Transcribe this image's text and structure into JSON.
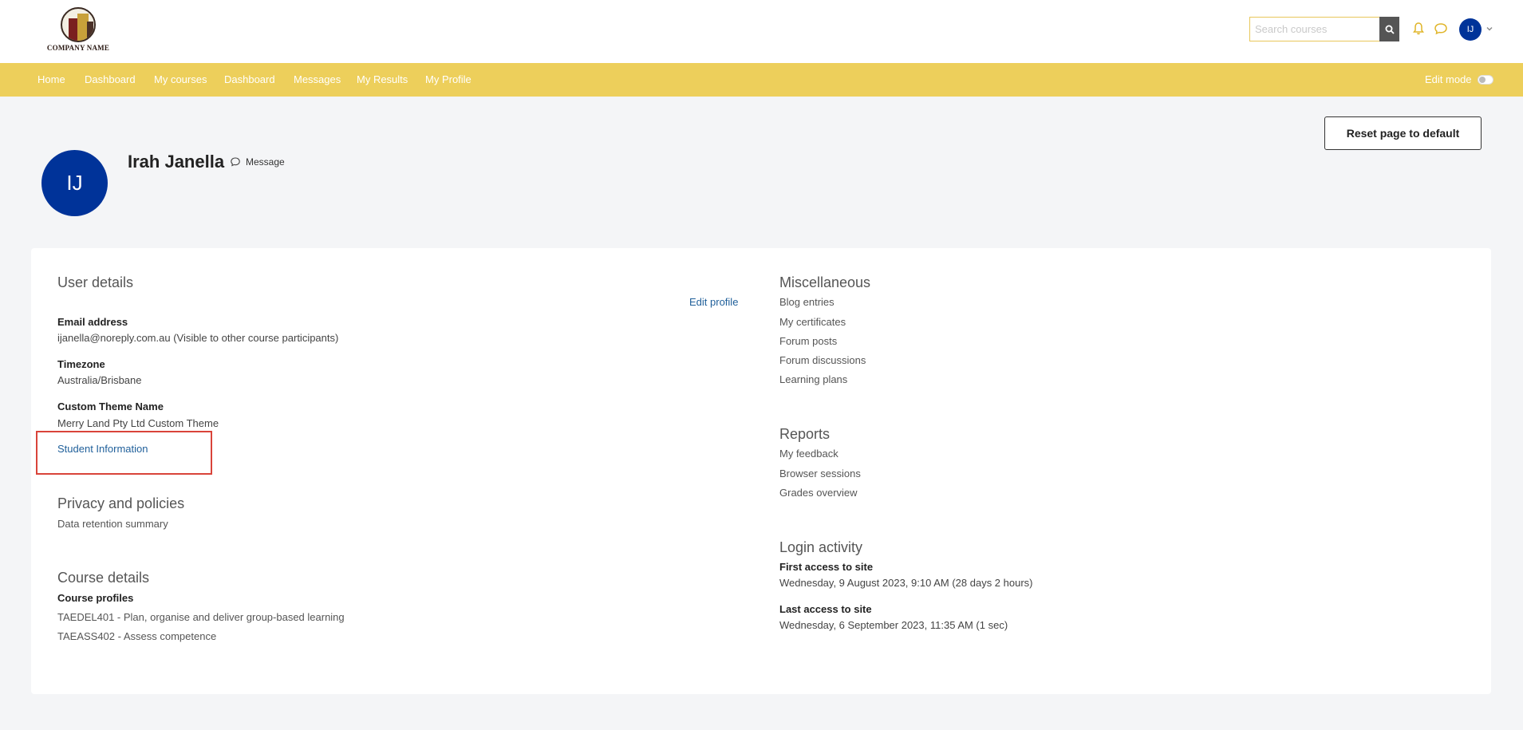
{
  "header": {
    "logo_text": "COMPANY NAME",
    "search_placeholder": "Search courses",
    "user_initials": "IJ",
    "icons": [
      "search-icon",
      "bell-icon",
      "chat-icon",
      "chevron-down-icon"
    ]
  },
  "nav": {
    "items": [
      "Home",
      "Dashboard",
      "My courses",
      "Dashboard",
      "Messages",
      "My Results",
      "My Profile"
    ],
    "edit_mode_label": "Edit mode",
    "edit_mode_on": false
  },
  "profile": {
    "reset_label": "Reset page to default",
    "initials": "IJ",
    "name": "Irah Janella",
    "message_label": "Message"
  },
  "user_details": {
    "heading": "User details",
    "edit_profile": "Edit profile",
    "email_label": "Email address",
    "email_value": "ijanella@noreply.com.au (Visible to other course participants)",
    "timezone_label": "Timezone",
    "timezone_value": "Australia/Brisbane",
    "theme_label": "Custom Theme Name",
    "theme_value": "Merry Land Pty Ltd Custom Theme",
    "student_info": "Student Information"
  },
  "privacy": {
    "heading": "Privacy and policies",
    "items": [
      "Data retention summary"
    ]
  },
  "course_details": {
    "heading": "Course details",
    "profiles_label": "Course profiles",
    "courses": [
      "TAEDEL401 - Plan, organise and deliver group-based learning",
      "TAEASS402 - Assess competence"
    ]
  },
  "misc": {
    "heading": "Miscellaneous",
    "items": [
      "Blog entries",
      "My certificates",
      "Forum posts",
      "Forum discussions",
      "Learning plans"
    ]
  },
  "reports": {
    "heading": "Reports",
    "items": [
      "My feedback",
      "Browser sessions",
      "Grades overview"
    ]
  },
  "login": {
    "heading": "Login activity",
    "first_label": "First access to site",
    "first_value": "Wednesday, 9 August 2023, 9:10 AM  (28 days 2 hours)",
    "last_label": "Last access to site",
    "last_value": "Wednesday, 6 September 2023, 11:35 AM  (1 sec)"
  },
  "colors": {
    "brand_yellow": "#edcf5b",
    "avatar_blue": "#003399",
    "link_blue": "#1f5f9a",
    "highlight_red": "#d9443a"
  }
}
